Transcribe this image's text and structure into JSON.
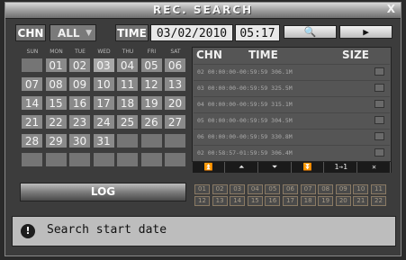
{
  "window": {
    "title": "REC. SEARCH",
    "close": "X"
  },
  "toolbar": {
    "chn_label": "CHN",
    "chn_value": "ALL",
    "time_label": "TIME",
    "date_value": "03/02/2010",
    "time_value": "05:17",
    "search_glyph": "🔍",
    "play_glyph": "▶"
  },
  "calendar": {
    "weekdays": [
      "SUN",
      "MON",
      "TUE",
      "WED",
      "THU",
      "FRI",
      "SAT"
    ],
    "start_offset": 1,
    "days": [
      "01",
      "02",
      "03",
      "04",
      "05",
      "06",
      "07",
      "08",
      "09",
      "10",
      "11",
      "12",
      "13",
      "14",
      "15",
      "16",
      "17",
      "18",
      "19",
      "20",
      "21",
      "22",
      "23",
      "24",
      "25",
      "26",
      "27",
      "28",
      "29",
      "30",
      "31"
    ],
    "selected_day": "03"
  },
  "file_list": {
    "headers": {
      "chn": "CHN",
      "time": "TIME",
      "size": "SIZE"
    },
    "rows": [
      "02 00:00:00-00:59:59 306.1M",
      "03 00:00:00-00:59:59 325.5M",
      "04 00:00:00-00:59:59 315.1M",
      "05 00:00:00-00:59:59 304.5M",
      "06 00:00:00-00:59:59 330.8M",
      "02 00:58:57-01:59:59 306.4M"
    ],
    "pager": [
      "⏫",
      "⏶",
      "⏷",
      "⏬",
      "1→1",
      "✕"
    ]
  },
  "log_label": "LOG",
  "channels": [
    "01",
    "02",
    "03",
    "04",
    "05",
    "06",
    "07",
    "08",
    "09",
    "10",
    "11",
    "12",
    "13",
    "14",
    "15",
    "16",
    "17",
    "18",
    "19",
    "20",
    "21",
    "22"
  ],
  "status": {
    "icon": "!",
    "text": "Search start date"
  }
}
